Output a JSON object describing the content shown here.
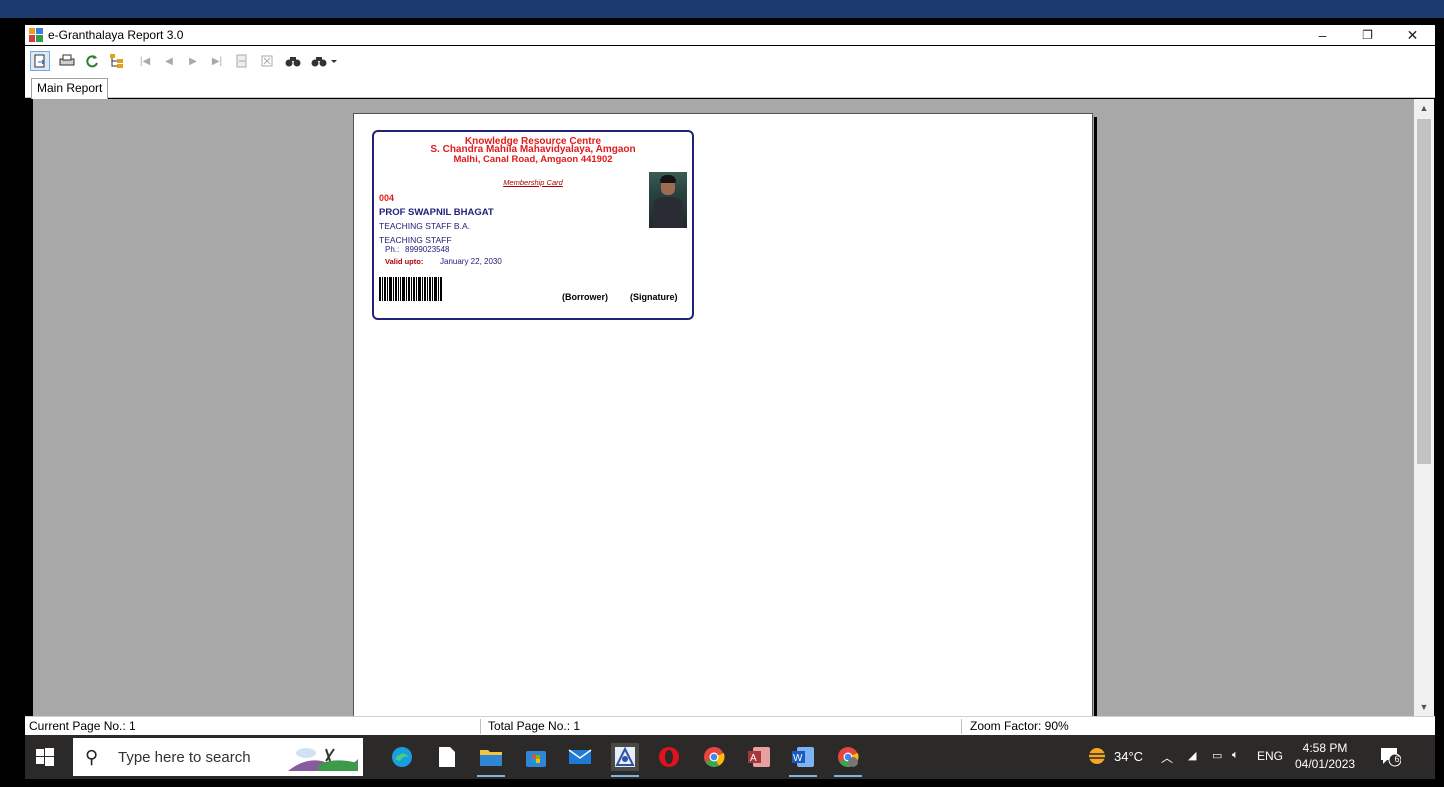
{
  "window": {
    "title": "e-Granthalaya Report 3.0",
    "controls": {
      "minimize": "–",
      "restore": "❐",
      "close": "✕"
    }
  },
  "toolbar": {
    "icons": [
      "export-icon",
      "print-icon",
      "refresh-icon",
      "group-tree-icon",
      "first-page-icon",
      "previous-page-icon",
      "next-page-icon",
      "last-page-icon",
      "goto-page-icon",
      "close-view-icon",
      "search-text-icon",
      "zoom-icon"
    ]
  },
  "tabs": [
    {
      "label": "Main Report"
    }
  ],
  "card": {
    "header": [
      "Knowledge Resource Centre",
      "S. Chandra Mahila Mahavidyalaya, Amgaon",
      "Malhi, Canal Road, Amgaon 441902"
    ],
    "title": "Membership Card",
    "member_no": "004",
    "name": "PROF SWAPNIL BHAGAT",
    "line1": "TEACHING STAFF B.A.",
    "line2": "TEACHING STAFF",
    "phone_label": "Ph.:",
    "phone": "8999023548",
    "valid_label": "Valid upto:",
    "valid_date": "January 22, 2030",
    "borrower": "(Borrower)",
    "signature": "(Signature)"
  },
  "status": {
    "current_page": "Current Page No.: 1",
    "total_page": "Total Page No.: 1",
    "zoom": "Zoom Factor: 90%"
  },
  "taskbar": {
    "search_placeholder": "Type here to search",
    "apps": [
      "edge-icon",
      "notepad-icon",
      "file-explorer-icon",
      "store-icon",
      "mail-icon",
      "granthalaya-icon",
      "opera-icon",
      "chrome-icon",
      "access-icon",
      "word-icon",
      "chrome-alt-icon"
    ],
    "weather": "34°C",
    "language": "ENG",
    "time": "4:58 PM",
    "date": "04/01/2023",
    "notifications": "6"
  }
}
